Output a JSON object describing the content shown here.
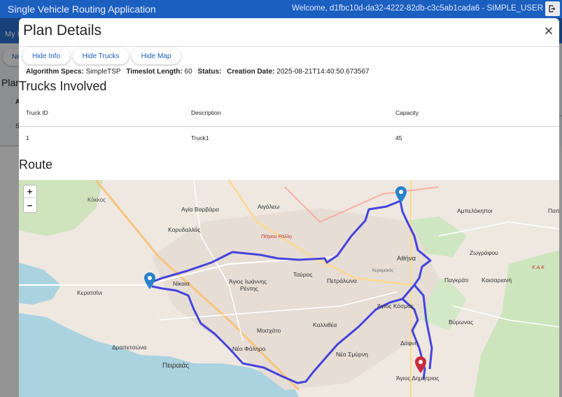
{
  "app": {
    "title": "Single Vehicle Routing Application",
    "welcome": "Welcome, d1fbc10d-da32-4222-82db-c3c5ab1cada6 - SIMPLE_USER"
  },
  "background": {
    "tab_label": "My P",
    "new_button": "Ne",
    "section_title": "Plar",
    "col_a": "A",
    "row_s": "S"
  },
  "modal": {
    "title": "Plan Details",
    "buttons": {
      "hide_info": "Hide Info",
      "hide_trucks": "Hide Trucks",
      "hide_map": "Hide Map"
    },
    "specs": {
      "algorithm_label": "Algorithm Specs:",
      "algorithm_value": "SimpleTSP",
      "timeslot_label": "Timeslot Length:",
      "timeslot_value": "60",
      "status_label": "Status:",
      "status_value": "",
      "creation_label": "Creation Date:",
      "creation_value": "2025-08-21T14:40:50.673567"
    },
    "trucks_heading": "Trucks Involved",
    "table": {
      "columns": [
        "Truck ID",
        "Description",
        "Capacity"
      ],
      "rows": [
        [
          "1",
          "Truck1",
          "45"
        ]
      ]
    },
    "route_heading": "Route"
  },
  "map": {
    "zoom_in": "+",
    "zoom_out": "−",
    "labels": {
      "agia_varvara": "Αγία Βαρβάρα",
      "aigaleo": "Αιγάλεω",
      "korydallos": "Κορυδαλλός",
      "nikaia": "Νίκαια",
      "tavros": "Ταύρος",
      "agios_ioannis": "Άγιος Ιωάννης",
      "rentis": "Ρέντης",
      "petralona": "Πετράλωνα",
      "athina": "Αθήνα",
      "pagkrati": "Παγκράτι",
      "kaisariani": "Καισαριανή",
      "zografou": "Ζωγράφου",
      "ampelokipoi": "Αμπελόκηποι",
      "vyronas": "Βύρωνας",
      "keratsini": "Κερατσίνι",
      "drapetsona": "Δραπετσώνα",
      "peiraias": "Πειραιάς",
      "moschato": "Μοσχάτο",
      "kallithea": "Καλλιθέα",
      "neo_faliro": "Νέο Φάληρο",
      "nea_smyrni": "Νέα Σμύρνη",
      "agios_dimitrios": "Άγιος Δημήτριος",
      "dafni": "Δάφνη",
      "agios_kosmas": "Άγιος Κόσμος",
      "petrou_ralli": "Πέτρου Ράλλη",
      "kerameikos": "Κεραμεικός",
      "kokkos": "Κόκκος",
      "pap": "Παπ",
      "kak": "Κ.Α.Κ"
    },
    "route_color": "#3333dd",
    "marker_start_color": "#2a81cb",
    "marker_end_color": "#cb2b3e"
  }
}
